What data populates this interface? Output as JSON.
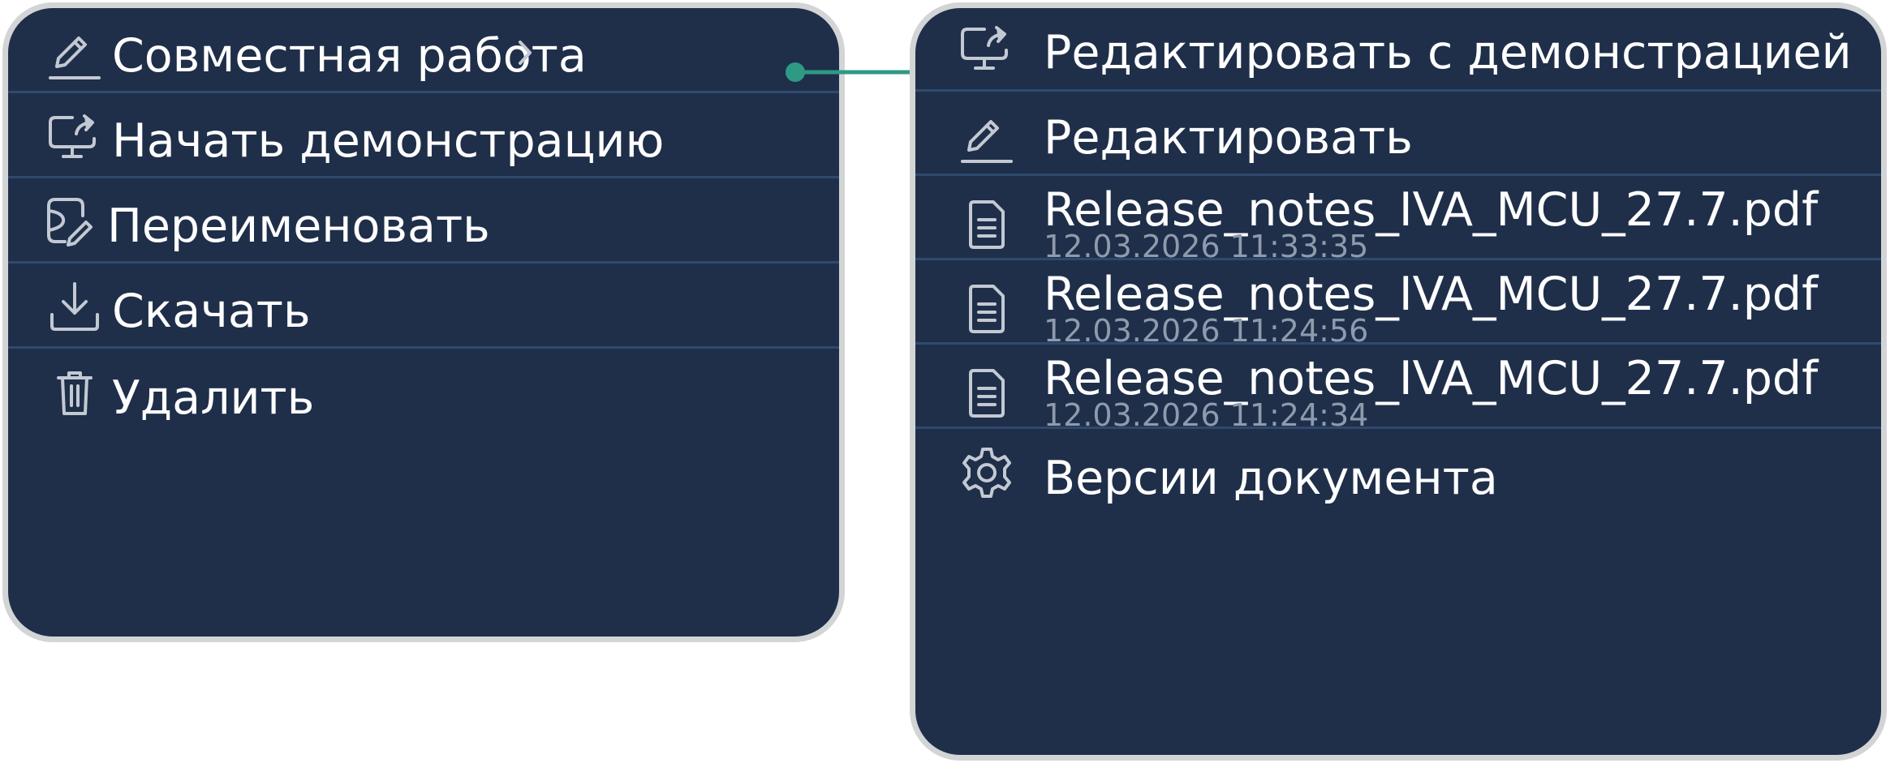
{
  "main_menu": {
    "items": [
      {
        "label": "Совместная работа",
        "icon": "pencil-icon",
        "has_submenu": true
      },
      {
        "label": "Начать демонстрацию",
        "icon": "screen-share-icon"
      },
      {
        "label": "Переименовать",
        "icon": "rename-icon"
      },
      {
        "label": "Скачать",
        "icon": "download-icon"
      },
      {
        "label": "Удалить",
        "icon": "trash-icon"
      }
    ]
  },
  "submenu": {
    "items": [
      {
        "label": "Редактировать с демонстрацией",
        "icon": "screen-share-icon"
      },
      {
        "label": "Редактировать",
        "icon": "pencil-icon"
      }
    ],
    "versions": [
      {
        "filename": "Release_notes_IVA_MCU_27.7.pdf",
        "timestamp": "12.03.2026 11:33:35",
        "icon": "document-icon"
      },
      {
        "filename": "Release_notes_IVA_MCU_27.7.pdf",
        "timestamp": "12.03.2026 11:24:56",
        "icon": "document-icon"
      },
      {
        "filename": "Release_notes_IVA_MCU_27.7.pdf",
        "timestamp": "12.03.2026 11:24:34",
        "icon": "document-icon"
      }
    ],
    "footer_item": {
      "label": "Версии документа",
      "icon": "gear-icon"
    }
  },
  "colors": {
    "menu_background": "#1f2f4a",
    "menu_border": "#d3d4d6",
    "divider": "#2e4a6e",
    "text": "#ffffff",
    "secondary_text": "#8f9bad",
    "icon": "#c3c9d3",
    "connector_accent": "#2e9a84"
  }
}
